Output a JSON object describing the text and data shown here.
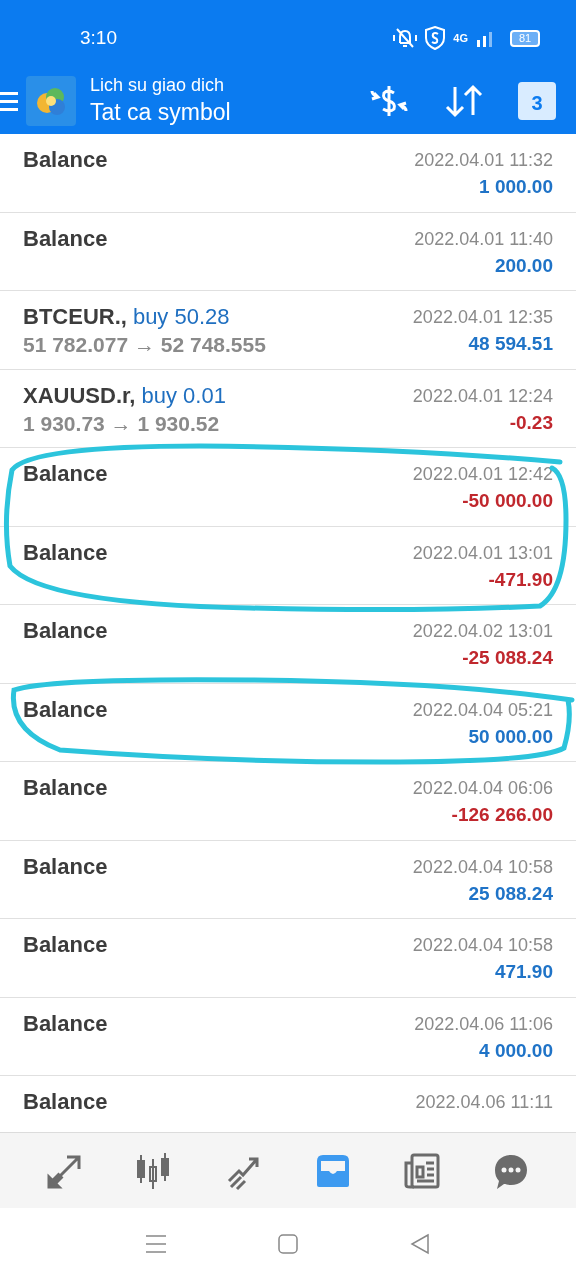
{
  "status_bar": {
    "time": "3:10",
    "battery": "81",
    "network": "4G"
  },
  "toolbar": {
    "subtitle": "Lich su giao dich",
    "title": "Tat ca symbol",
    "calendar_day": "3"
  },
  "rows": [
    {
      "kind": "balance",
      "title": "Balance",
      "time": "2022.04.01 11:32",
      "amount": "1 000.00",
      "loss": false
    },
    {
      "kind": "balance",
      "title": "Balance",
      "time": "2022.04.01 11:40",
      "amount": "200.00",
      "loss": false
    },
    {
      "kind": "trade",
      "title": "BTCEUR.,",
      "side": "buy 50.28",
      "prices": "51 782.077 → 52 748.555",
      "time": "2022.04.01 12:35",
      "amount": "48 594.51",
      "loss": false
    },
    {
      "kind": "trade",
      "title": "XAUUSD.r,",
      "side": "buy 0.01",
      "prices": "1 930.73 → 1 930.52",
      "time": "2022.04.01 12:24",
      "amount": "-0.23",
      "loss": true
    },
    {
      "kind": "balance",
      "title": "Balance",
      "time": "2022.04.01 12:42",
      "amount": "-50 000.00",
      "loss": true
    },
    {
      "kind": "balance",
      "title": "Balance",
      "time": "2022.04.01 13:01",
      "amount": "-471.90",
      "loss": true
    },
    {
      "kind": "balance",
      "title": "Balance",
      "time": "2022.04.02 13:01",
      "amount": "-25 088.24",
      "loss": true
    },
    {
      "kind": "balance",
      "title": "Balance",
      "time": "2022.04.04 05:21",
      "amount": "50 000.00",
      "loss": false
    },
    {
      "kind": "balance",
      "title": "Balance",
      "time": "2022.04.04 06:06",
      "amount": "-126 266.00",
      "loss": true
    },
    {
      "kind": "balance",
      "title": "Balance",
      "time": "2022.04.04 10:58",
      "amount": "25 088.24",
      "loss": false
    },
    {
      "kind": "balance",
      "title": "Balance",
      "time": "2022.04.04 10:58",
      "amount": "471.90",
      "loss": false
    },
    {
      "kind": "balance",
      "title": "Balance",
      "time": "2022.04.06 11:06",
      "amount": "4 000.00",
      "loss": false
    },
    {
      "kind": "balance",
      "title": "Balance",
      "time": "2022.04.06 11:11"
    }
  ],
  "bottom_nav": [
    {
      "kind": "quotes",
      "selected": false
    },
    {
      "kind": "chart",
      "selected": false
    },
    {
      "kind": "trade",
      "selected": false
    },
    {
      "kind": "history",
      "selected": true
    },
    {
      "kind": "news",
      "selected": false
    },
    {
      "kind": "chat",
      "selected": false
    }
  ]
}
